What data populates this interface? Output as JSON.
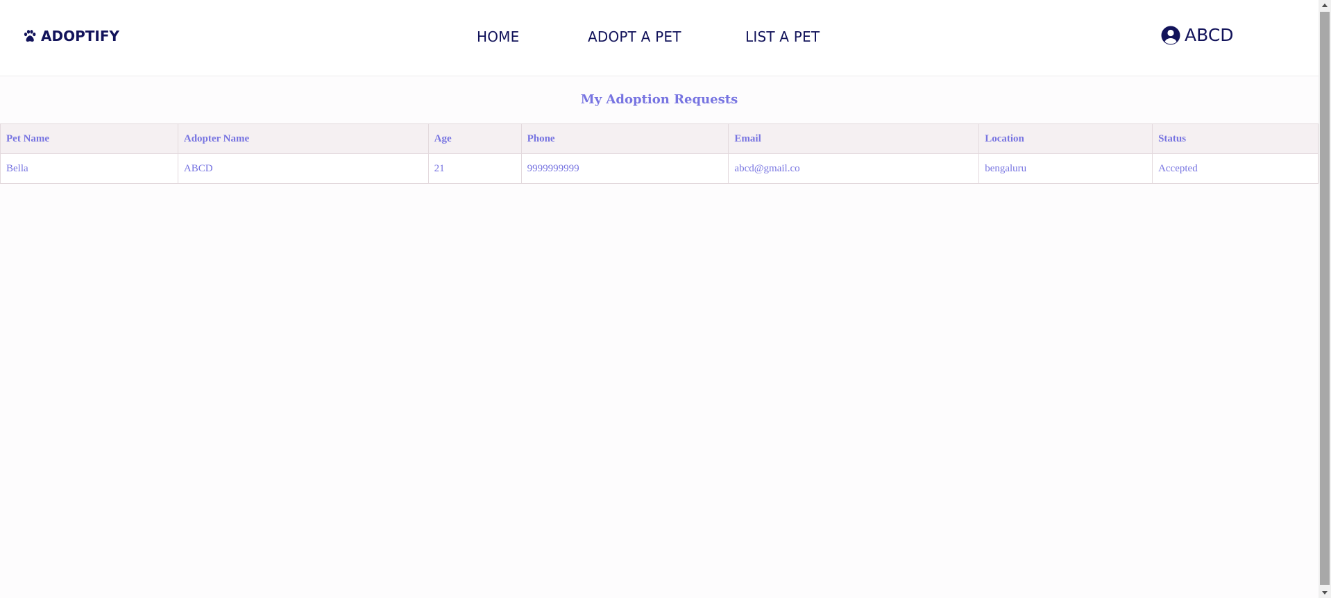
{
  "navbar": {
    "brand": "ADOPTIFY",
    "links": [
      "HOME",
      "ADOPT A PET",
      "LIST A PET"
    ],
    "user_name": "ABCD"
  },
  "page": {
    "title": "My Adoption Requests"
  },
  "table": {
    "headers": [
      "Pet Name",
      "Adopter Name",
      "Age",
      "Phone",
      "Email",
      "Location",
      "Status"
    ],
    "rows": [
      [
        "Bella",
        "ABCD",
        "21",
        "9999999999",
        "abcd@gmail.co",
        "bengaluru",
        "Accepted"
      ]
    ]
  },
  "colors": {
    "nav_text": "#12135a",
    "accent": "#7774e1",
    "header_bg": "#f5f0f2"
  },
  "icons": {
    "brand": "paw-icon",
    "user": "user-circle-icon",
    "scroll_up": "triangle-up-icon",
    "scroll_down": "triangle-down-icon"
  }
}
